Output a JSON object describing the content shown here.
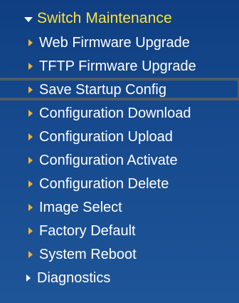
{
  "menu": {
    "section_label": "Switch Maintenance",
    "items": [
      {
        "label": "Web Firmware Upgrade"
      },
      {
        "label": "TFTP Firmware Upgrade"
      },
      {
        "label": "Save Startup Config"
      },
      {
        "label": "Configuration Download"
      },
      {
        "label": "Configuration Upload"
      },
      {
        "label": "Configuration Activate"
      },
      {
        "label": "Configuration Delete"
      },
      {
        "label": "Image Select"
      },
      {
        "label": "Factory Default"
      },
      {
        "label": "System Reboot"
      },
      {
        "label": "Diagnostics"
      }
    ],
    "highlighted_item": "Save Startup Config"
  },
  "colors": {
    "background": "#174a8e",
    "section_label": "#ffe33a",
    "item_text": "#ffffff",
    "item_arrow": "#f2b233",
    "highlight_border": "#555a62"
  },
  "icons": {
    "section": "caret-down-icon",
    "item": "caret-right-icon"
  }
}
